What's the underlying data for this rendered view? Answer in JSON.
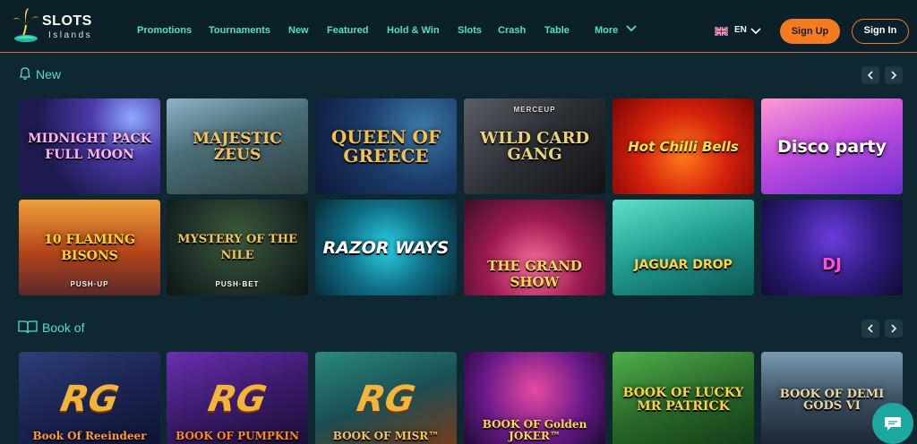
{
  "logo": {
    "title": "SLOTS",
    "subtitle": "Islands"
  },
  "nav": {
    "items": [
      {
        "label": "Promotions"
      },
      {
        "label": "Tournaments"
      },
      {
        "label": "New"
      },
      {
        "label": "Featured"
      },
      {
        "label": "Hold & Win"
      },
      {
        "label": "Slots"
      },
      {
        "label": "Crash"
      },
      {
        "label": "Table"
      },
      {
        "label": "More"
      }
    ]
  },
  "language": {
    "code": "EN",
    "flag": "uk-flag-icon"
  },
  "auth": {
    "signup_label": "Sign Up",
    "signin_label": "Sign In"
  },
  "colors": {
    "accent": "#52e0c2",
    "brand_orange": "#f47b20",
    "background": "#0f2730"
  },
  "sections": [
    {
      "title": "New",
      "icon": "bell-icon",
      "games": [
        {
          "name": "MIDNIGHT PACK FULL MOON"
        },
        {
          "name": "MAJESTIC ZEUS"
        },
        {
          "name": "QUEEN OF GREECE"
        },
        {
          "name": "WILD CARD GANG",
          "sub": "MERCEUP"
        },
        {
          "name": "Hot Chilli Bells"
        },
        {
          "name": "Disco party"
        },
        {
          "name": "10 FLAMING BISONS",
          "sub": "PUSH·UP"
        },
        {
          "name": "MYSTERY OF THE NILE",
          "sub": "PUSH·BET"
        },
        {
          "name": "RAZOR WAYS"
        },
        {
          "name": "THE GRAND SHOW"
        },
        {
          "name": "JAGUAR DROP"
        },
        {
          "name": "DJ"
        }
      ]
    },
    {
      "title": "Book of",
      "icon": "book-icon",
      "games": [
        {
          "name": "Book Of Reeindeer",
          "badge": "RG"
        },
        {
          "name": "BOOK OF PUMPKIN",
          "badge": "RG"
        },
        {
          "name": "BOOK OF MISR™",
          "badge": "RG"
        },
        {
          "name": "BOOK OF Golden JOKER™"
        },
        {
          "name": "BOOK OF LUCKY MR PATRICK"
        },
        {
          "name": "BOOK OF DEMI GODS VI"
        }
      ]
    }
  ]
}
